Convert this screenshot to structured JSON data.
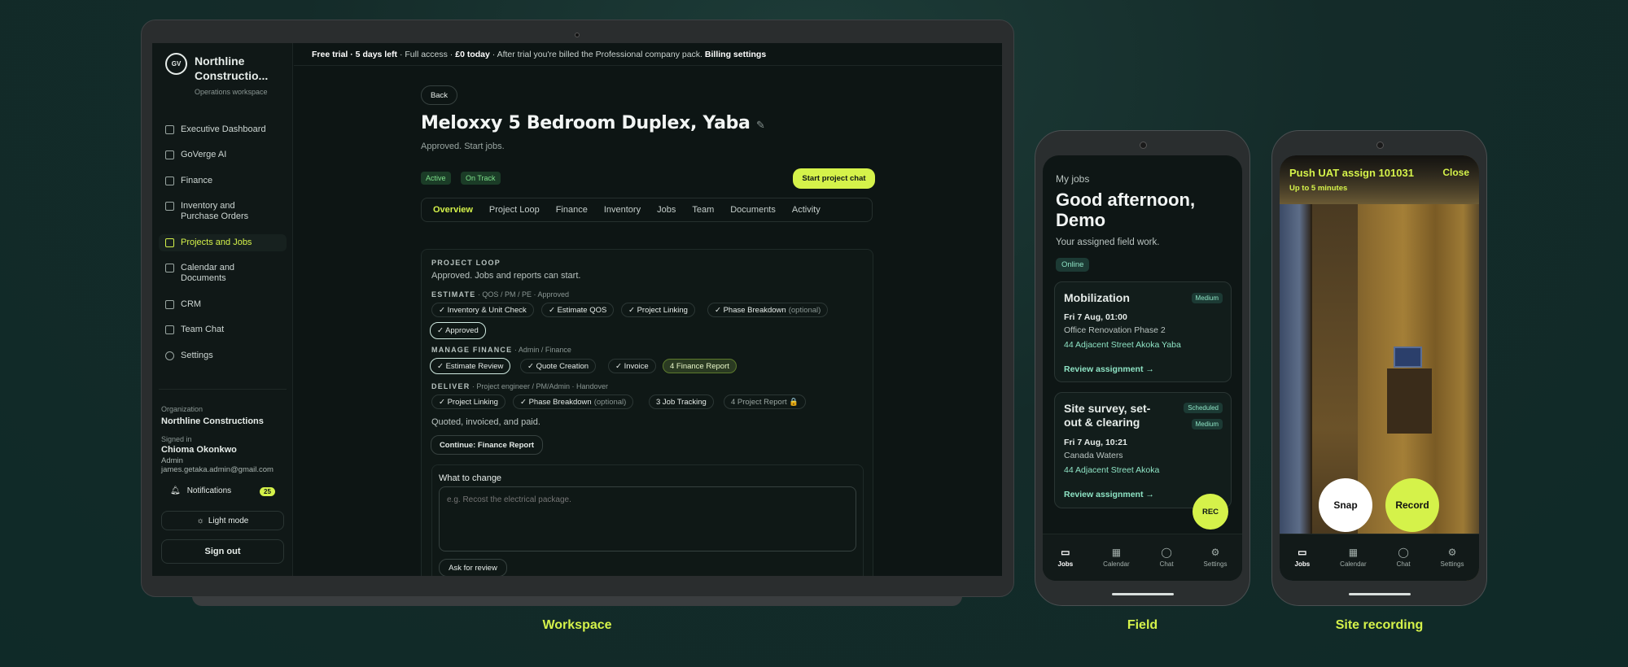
{
  "workspace": {
    "caption": "Workspace",
    "sidebar": {
      "logo": "GV",
      "org_line1": "Northline",
      "org_line2": "Constructio...",
      "subtitle": "Operations workspace",
      "items": [
        {
          "label": "Executive Dashboard",
          "icon": "dashboard-icon"
        },
        {
          "label": "GoVerge AI",
          "icon": "ai-icon"
        },
        {
          "label": "Finance",
          "icon": "finance-icon"
        },
        {
          "label": "Inventory and Purchase Orders",
          "icon": "inventory-icon"
        },
        {
          "label": "Projects and Jobs",
          "icon": "folder-icon"
        },
        {
          "label": "Calendar and Documents",
          "icon": "calendar-icon"
        },
        {
          "label": "CRM",
          "icon": "crm-icon"
        },
        {
          "label": "Team Chat",
          "icon": "chat-icon"
        },
        {
          "label": "Settings",
          "icon": "user-icon"
        }
      ],
      "organization_label": "Organization",
      "organization_value": "Northline Constructions",
      "signed_in_label": "Signed in",
      "user_name": "Chioma Okonkwo",
      "user_role": "Admin",
      "user_email": "james.getaka.admin@gmail.com",
      "notifications_label": "Notifications",
      "notifications_count": "25",
      "light_mode_label": "Light mode",
      "sign_out_label": "Sign out"
    },
    "banner": {
      "trial": "Free trial · 5 days left",
      "sep1": " · Full access · ",
      "price": "£0 today",
      "rest": " · After trial you're billed the Professional company pack. ",
      "link": "Billing settings"
    },
    "back_label": "Back",
    "project_title": "Meloxxy 5 Bedroom Duplex, Yaba",
    "project_subtitle": "Approved. Start jobs.",
    "status_badges": [
      "Active",
      "On Track"
    ],
    "start_chat_label": "Start project chat",
    "tabs": [
      "Overview",
      "Project Loop",
      "Finance",
      "Inventory",
      "Jobs",
      "Team",
      "Documents",
      "Activity"
    ],
    "loop": {
      "heading": "PROJECT LOOP",
      "desc": "Approved. Jobs and reports can start.",
      "estimate_heading": "ESTIMATE",
      "estimate_sub": " · QOS / PM / PE  · Approved",
      "estimate_chips": [
        "✓ Inventory & Unit Check",
        "✓ Estimate QOS",
        "✓ Project Linking",
        "✓ Phase Breakdown",
        "✓ Approved"
      ],
      "optional": "(optional)",
      "finance_heading": "MANAGE FINANCE",
      "finance_sub": " · Admin / Finance",
      "finance_chips": [
        "✓ Estimate Review",
        "✓ Quote Creation",
        "✓ Invoice",
        "4 Finance Report"
      ],
      "deliver_heading": "DELIVER",
      "deliver_sub": " · Project engineer / PM/Admin  · Handover",
      "deliver_chips": [
        "✓ Project Linking",
        "✓ Phase Breakdown",
        "3 Job Tracking",
        "4 Project Report 🔒"
      ],
      "status_text": "Quoted, invoiced, and paid.",
      "continue_label": "Continue: Finance Report",
      "change_label": "What to change",
      "change_placeholder": "e.g. Recost the electrical package.",
      "ask_review_label": "Ask for review"
    }
  },
  "field": {
    "caption": "Field",
    "header": "My jobs",
    "greeting": "Good afternoon, Demo",
    "sub": "Your assigned field work.",
    "online": "Online",
    "cards": [
      {
        "title": "Mobilization",
        "tags": [
          "Medium"
        ],
        "date": "Fri 7 Aug, 01:00",
        "project": "Office Renovation Phase 2",
        "address": "44 Adjacent Street Akoka Yaba",
        "link": "Review assignment →"
      },
      {
        "title": "Site survey, set-out & clearing",
        "tags": [
          "Scheduled",
          "Medium"
        ],
        "date": "Fri 7 Aug, 10:21",
        "project": "Canada Waters",
        "address": "44 Adjacent Street Akoka",
        "link": "Review assignment →"
      }
    ],
    "rec": "REC",
    "nav": [
      "Jobs",
      "Calendar",
      "Chat",
      "Settings"
    ]
  },
  "recording": {
    "caption": "Site recording",
    "title": "Push UAT assign 101031",
    "close": "Close",
    "duration": "Up to 5 minutes",
    "snap": "Snap",
    "record": "Record",
    "nav": [
      "Jobs",
      "Calendar",
      "Chat",
      "Settings"
    ]
  }
}
